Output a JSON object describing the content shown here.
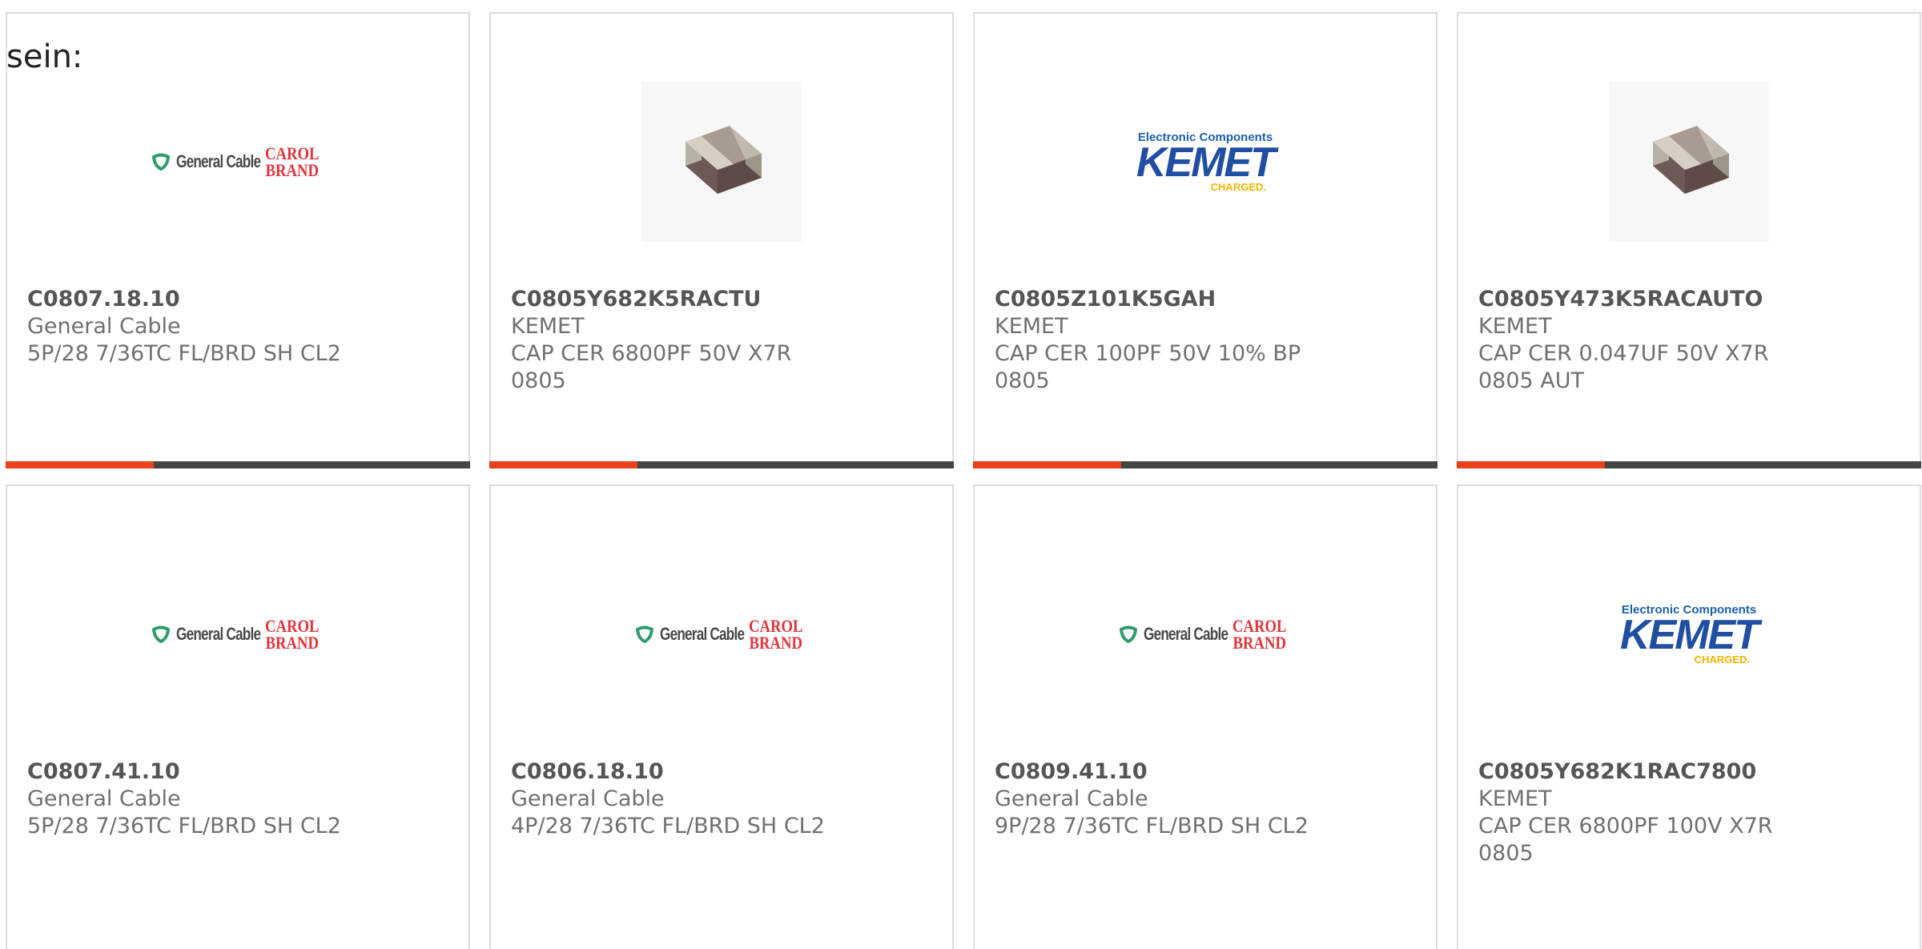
{
  "intro_text": "sein:",
  "colors": {
    "accent": "#e8401c",
    "bar": "#444444"
  },
  "cards": [
    {
      "part_number": "C0807.18.10",
      "manufacturer": "General Cable",
      "description": "5P/28 7/36TC FL/BRD SH CL2",
      "image": "general-cable-logo",
      "logo": {
        "brand": "General Cable",
        "sub_line1": "CAROL",
        "sub_line2": "BRAND"
      }
    },
    {
      "part_number": "C0805Y682K5RACTU",
      "manufacturer": "KEMET",
      "description": "CAP CER 6800PF 50V X7R 0805",
      "image": "ceramic-capacitor-chip"
    },
    {
      "part_number": "C0805Z101K5GAH",
      "manufacturer": "KEMET",
      "description": "CAP CER 100PF 50V 10% BP 0805",
      "image": "kemet-logo",
      "logo": {
        "top": "Electronic Components",
        "main": "KEMET",
        "sub": "CHARGED."
      }
    },
    {
      "part_number": "C0805Y473K5RACAUTO",
      "manufacturer": "KEMET",
      "description": "CAP CER 0.047UF 50V X7R 0805 AUT",
      "image": "ceramic-capacitor-chip"
    },
    {
      "part_number": "C0807.41.10",
      "manufacturer": "General Cable",
      "description": "5P/28 7/36TC FL/BRD SH CL2",
      "image": "general-cable-logo",
      "logo": {
        "brand": "General Cable",
        "sub_line1": "CAROL",
        "sub_line2": "BRAND"
      }
    },
    {
      "part_number": "C0806.18.10",
      "manufacturer": "General Cable",
      "description": "4P/28 7/36TC FL/BRD SH CL2",
      "image": "general-cable-logo",
      "logo": {
        "brand": "General Cable",
        "sub_line1": "CAROL",
        "sub_line2": "BRAND"
      }
    },
    {
      "part_number": "C0809.41.10",
      "manufacturer": "General Cable",
      "description": "9P/28 7/36TC FL/BRD SH CL2",
      "image": "general-cable-logo",
      "logo": {
        "brand": "General Cable",
        "sub_line1": "CAROL",
        "sub_line2": "BRAND"
      }
    },
    {
      "part_number": "C0805Y682K1RAC7800",
      "manufacturer": "KEMET",
      "description": "CAP CER 6800PF 100V X7R 0805",
      "image": "kemet-logo",
      "logo": {
        "top": "Electronic Components",
        "main": "KEMET",
        "sub": "CHARGED."
      }
    }
  ]
}
